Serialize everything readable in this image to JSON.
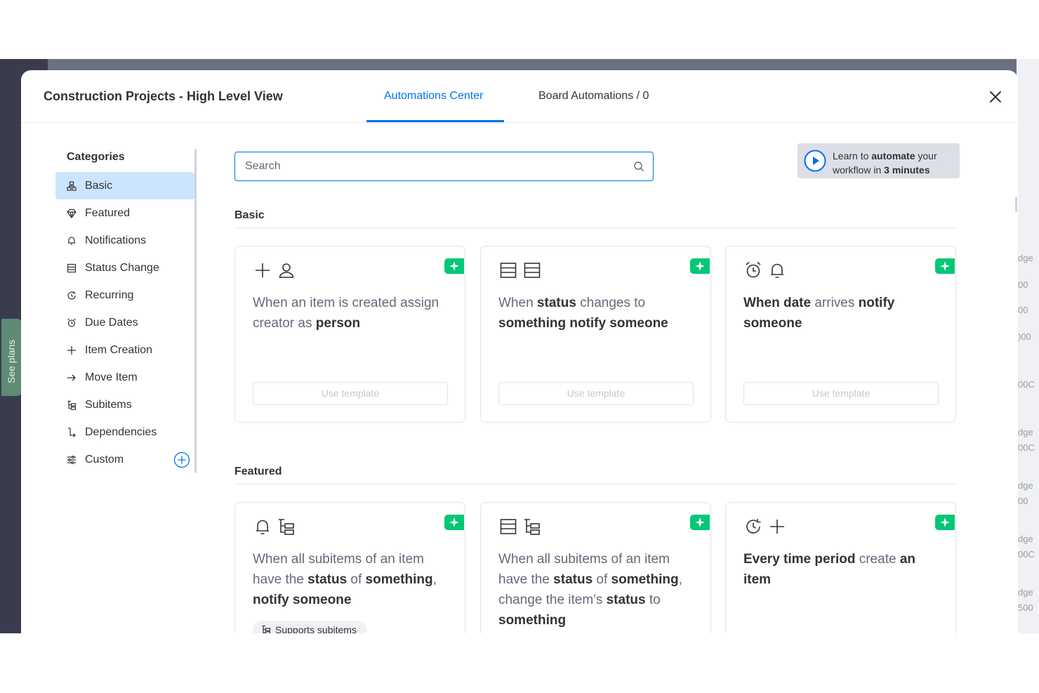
{
  "background": {
    "see_plans_label": "See plans",
    "right_fragments": [
      "dge",
      "00",
      "00",
      ")00",
      "00C",
      "dge",
      "00C",
      "dge",
      "00",
      "dge",
      "00C",
      "dge",
      "500"
    ]
  },
  "header": {
    "board_title": "Construction Projects - High Level View",
    "tabs": [
      {
        "label": "Automations Center",
        "active": true
      },
      {
        "label": "Board Automations / 0",
        "active": false
      }
    ],
    "close_icon": "close-icon"
  },
  "sidebar": {
    "title": "Categories",
    "items": [
      {
        "label": "Basic",
        "icon": "hierarchy-icon",
        "active": true
      },
      {
        "label": "Featured",
        "icon": "diamond-icon"
      },
      {
        "label": "Notifications",
        "icon": "bell-icon"
      },
      {
        "label": "Status Change",
        "icon": "status-icon"
      },
      {
        "label": "Recurring",
        "icon": "recurring-icon"
      },
      {
        "label": "Due Dates",
        "icon": "alarm-icon"
      },
      {
        "label": "Item Creation",
        "icon": "plus-icon"
      },
      {
        "label": "Move Item",
        "icon": "arrow-right-icon"
      },
      {
        "label": "Subitems",
        "icon": "subitems-icon"
      },
      {
        "label": "Dependencies",
        "icon": "dependency-icon"
      },
      {
        "label": "Custom",
        "icon": "sliders-icon"
      }
    ]
  },
  "search": {
    "placeholder": "Search",
    "value": ""
  },
  "learn": {
    "pre": "Learn to ",
    "bold1": "automate",
    "mid": " your workflow in ",
    "bold2": "3 minutes"
  },
  "sections": {
    "basic": "Basic",
    "featured": "Featured"
  },
  "cards": {
    "use_template_label": "Use template",
    "supports_subitems_label": "Supports subitems",
    "basic": [
      {
        "icons": [
          "plus-icon",
          "person-icon"
        ],
        "parts": [
          "When an item is created assign creator as ",
          "person"
        ]
      },
      {
        "icons": [
          "status-icon",
          "status-icon"
        ],
        "parts": [
          "When ",
          "status",
          " changes to ",
          "something notify someone"
        ]
      },
      {
        "icons": [
          "alarm-icon",
          "bell-icon"
        ],
        "parts": [
          "When date",
          " arrives ",
          "notify someone"
        ]
      }
    ],
    "featured": [
      {
        "icons": [
          "bell-icon",
          "subitems-icon"
        ],
        "parts": [
          "When all subitems of an item have the ",
          "status",
          " of ",
          "something",
          ", ",
          "notify someone"
        ]
      },
      {
        "icons": [
          "status-icon",
          "subitems-icon"
        ],
        "parts": [
          "When all subitems of an item have the ",
          "status",
          " of ",
          "something",
          ", change the item's ",
          "status",
          " to ",
          "something"
        ]
      },
      {
        "icons": [
          "recurring-icon",
          "plus-icon"
        ],
        "parts": [
          "Every time period",
          " create ",
          "an item"
        ]
      }
    ]
  },
  "colors": {
    "accent": "#0073ea",
    "badge": "#00c875",
    "active_bg": "#cce5ff"
  }
}
